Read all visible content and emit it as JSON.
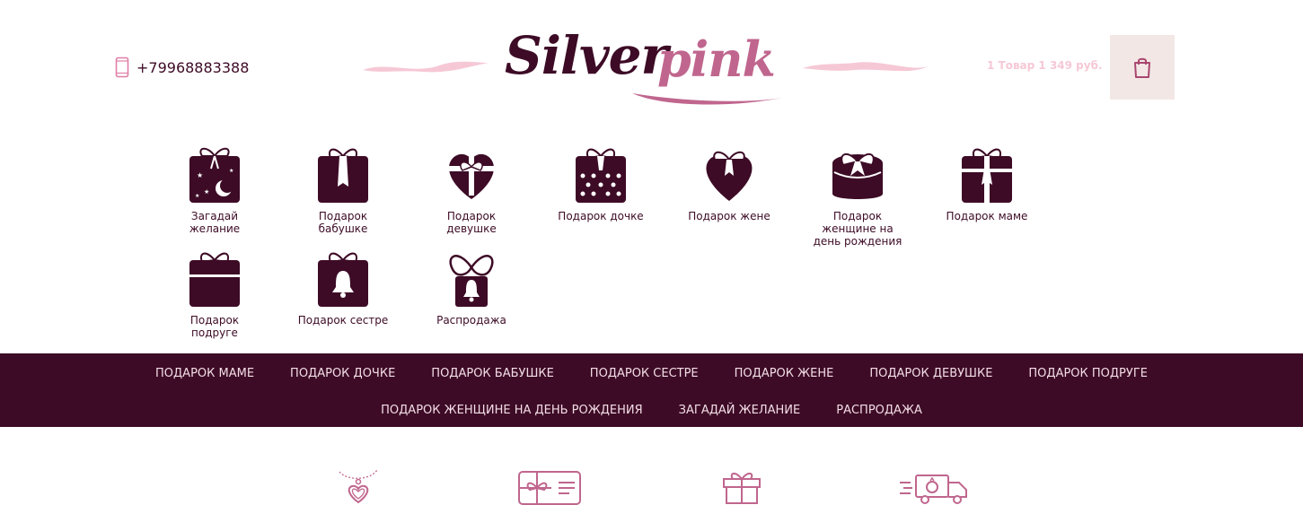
{
  "header": {
    "phone": "+79968883388",
    "logo": {
      "part1": "Silver",
      "part2": "pink"
    },
    "cart_summary": "1 Товар 1 349 руб."
  },
  "categories": [
    {
      "label": "Загадай желание",
      "icon": "gift-box-stars-moon-icon"
    },
    {
      "label": "Подарок бабушке",
      "icon": "gift-box-bow-icon"
    },
    {
      "label": "Подарок девушке",
      "icon": "heart-gift-box-icon"
    },
    {
      "label": "Подарок дочке",
      "icon": "polka-dot-gift-box-icon"
    },
    {
      "label": "Подарок жене",
      "icon": "heart-bow-icon"
    },
    {
      "label": "Подарок женщине на день рождения",
      "icon": "round-gift-box-icon"
    },
    {
      "label": "Подарок маме",
      "icon": "gift-box-ribbon-icon"
    },
    {
      "label": "Подарок подруге",
      "icon": "plain-gift-box-icon"
    },
    {
      "label": "Подарок сестре",
      "icon": "gift-box-bell-icon"
    },
    {
      "label": "Распродажа",
      "icon": "sale-gift-bell-icon"
    }
  ],
  "nav": {
    "row1": [
      "ПОДАРОК МАМЕ",
      "ПОДАРОК ДОЧКЕ",
      "ПОДАРОК БАБУШКЕ",
      "ПОДАРОК СЕСТРЕ",
      "ПОДАРОК ЖЕНЕ",
      "ПОДАРОК ДЕВУШКЕ",
      "ПОДАРОК ПОДРУГЕ"
    ],
    "row2": [
      "ПОДАРОК ЖЕНЩИНЕ НА ДЕНЬ РОЖДЕНИЯ",
      "ЗАГАДАЙ ЖЕЛАНИЕ",
      "РАСПРОДАЖА"
    ]
  },
  "features": [
    {
      "icon": "heart-pendant-icon"
    },
    {
      "icon": "gift-card-icon"
    },
    {
      "icon": "gift-icon"
    },
    {
      "icon": "delivery-truck-icon"
    }
  ],
  "colors": {
    "brand_dark": "#3d0b26",
    "brand_pink": "#c0668e",
    "light_pink": "#f6c8d6",
    "cart_bg": "#f3e7e5"
  }
}
